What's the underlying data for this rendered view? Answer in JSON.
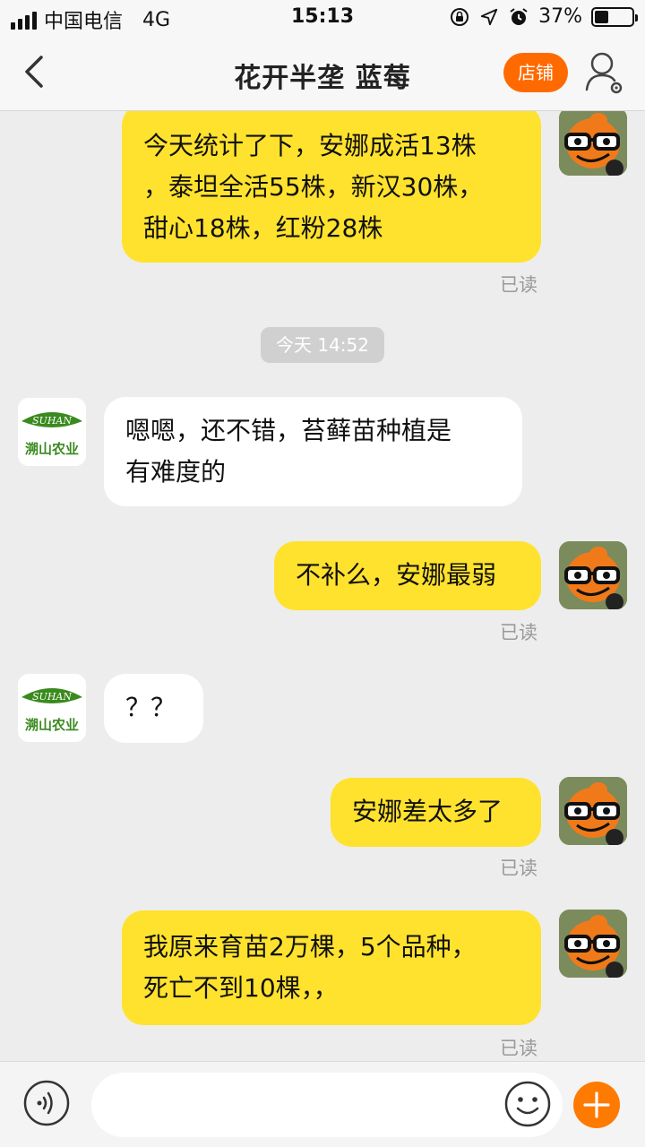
{
  "status_bar": {
    "carrier": "中国电信",
    "network": "4G",
    "time": "15:13",
    "battery_percent": "37%",
    "battery_level": 0.37
  },
  "nav": {
    "title": "花开半垄 蓝莓",
    "store_label": "店铺"
  },
  "chat": {
    "time_divider": "今天 14:52",
    "read_label": "已读",
    "shop_logo_brand": "SUHAN",
    "shop_logo_name": "溯山农业",
    "messages": [
      {
        "sender": "me",
        "lines": [
          "今天统计了下，安娜成活13株",
          "，泰坦全活55株，新汉30株，",
          "甜心18株，红粉28株"
        ]
      },
      {
        "sender": "them",
        "lines": [
          "嗯嗯，还不错，苔藓苗种植是",
          "有难度的"
        ]
      },
      {
        "sender": "me",
        "lines": [
          "不补么，安娜最弱"
        ]
      },
      {
        "sender": "them",
        "lines": [
          "？？"
        ]
      },
      {
        "sender": "me",
        "lines": [
          "安娜差太多了"
        ]
      },
      {
        "sender": "me",
        "lines": [
          "我原来育苗2万棵，5个品种，",
          "死亡不到10棵，，"
        ]
      }
    ]
  },
  "input_bar": {
    "placeholder": ""
  },
  "colors": {
    "my_bubble": "#ffe22d",
    "their_bubble": "#ffffff",
    "accent": "#ff6a00",
    "background": "#ededed",
    "logo_green": "#3a8a1e"
  }
}
